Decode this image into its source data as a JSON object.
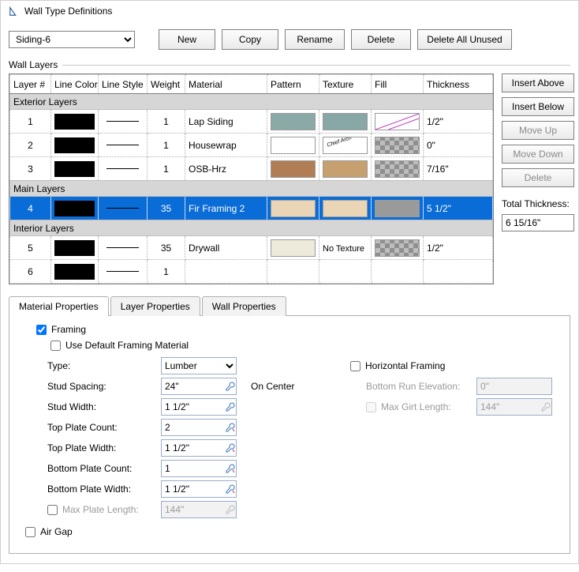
{
  "window": {
    "title": "Wall Type Definitions"
  },
  "toolbar": {
    "selected": "Siding-6",
    "new": "New",
    "copy": "Copy",
    "rename": "Rename",
    "delete": "Delete",
    "delete_unused": "Delete All Unused"
  },
  "layers": {
    "group_label": "Wall Layers",
    "headers": {
      "num": "Layer #",
      "color": "Line Color",
      "style": "Line Style",
      "weight": "Weight",
      "material": "Material",
      "pattern": "Pattern",
      "texture": "Texture",
      "fill": "Fill",
      "thickness": "Thickness"
    },
    "groups": {
      "exterior": "Exterior Layers",
      "main": "Main Layers",
      "interior": "Interior Layers"
    },
    "rows": [
      {
        "group": "exterior",
        "num": "1",
        "weight": "1",
        "material": "Lap Siding",
        "thickness": "1/2\"",
        "pattern": "#8aa9a7",
        "texture": "#87a8a7",
        "fill": "diag",
        "notex": false
      },
      {
        "group": "exterior",
        "num": "2",
        "weight": "1",
        "material": "Housewrap",
        "thickness": "0\"",
        "pattern": "#ffffff",
        "texture": "logo",
        "fill": "check",
        "notex": false
      },
      {
        "group": "exterior",
        "num": "3",
        "weight": "1",
        "material": "OSB-Hrz",
        "thickness": "7/16\"",
        "pattern": "#b07d55",
        "texture": "#c7a070",
        "fill": "check",
        "notex": false
      },
      {
        "group": "main",
        "num": "4",
        "weight": "35",
        "material": "Fir Framing 2",
        "thickness": "5 1/2\"",
        "pattern": "#ead6b7",
        "texture": "#ead6b7",
        "fill": "#9a9a9a",
        "notex": false,
        "selected": true
      },
      {
        "group": "interior",
        "num": "5",
        "weight": "35",
        "material": "Drywall",
        "thickness": "1/2\"",
        "pattern": "#eeeadb",
        "texture": "notex",
        "fill": "check",
        "notex": true
      },
      {
        "group": "interior",
        "num": "6",
        "weight": "1",
        "material": "",
        "thickness": "",
        "pattern": "",
        "texture": "",
        "fill": "",
        "notex": false
      }
    ]
  },
  "side": {
    "insert_above": "Insert Above",
    "insert_below": "Insert Below",
    "move_up": "Move Up",
    "move_down": "Move Down",
    "delete": "Delete",
    "total_label": "Total Thickness:",
    "total_value": "6 15/16\""
  },
  "tabs": {
    "material": "Material Properties",
    "layer": "Layer Properties",
    "wall": "Wall Properties"
  },
  "props": {
    "framing": "Framing",
    "use_default": "Use Default Framing Material",
    "type_label": "Type:",
    "type_value": "Lumber",
    "stud_spacing": "Stud Spacing:",
    "stud_spacing_v": "24\"",
    "on_center": "On Center",
    "stud_width": "Stud Width:",
    "stud_width_v": "1 1/2\"",
    "top_count": "Top Plate Count:",
    "top_count_v": "2",
    "top_width": "Top Plate Width:",
    "top_width_v": "1 1/2\"",
    "bot_count": "Bottom Plate Count:",
    "bot_count_v": "1",
    "bot_width": "Bottom Plate Width:",
    "bot_width_v": "1 1/2\"",
    "max_plate": "Max Plate Length:",
    "max_plate_v": "144\"",
    "horiz": "Horizontal Framing",
    "bot_run": "Bottom Run Elevation:",
    "bot_run_v": "0\"",
    "max_girt": "Max Girt Length:",
    "max_girt_v": "144\"",
    "air_gap": "Air Gap",
    "no_texture": "No Texture"
  }
}
